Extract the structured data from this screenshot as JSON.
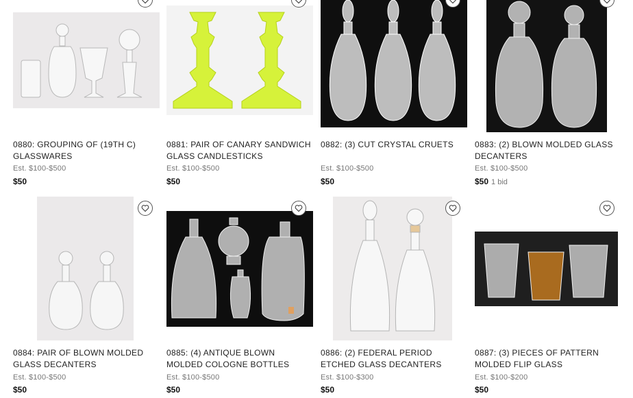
{
  "lots": [
    {
      "lot": "0880",
      "title": "GROUPING OF (19th C) GLASSWARES",
      "estimate": "Est.  $100-$500",
      "price": "$50",
      "bids": ""
    },
    {
      "lot": "0881",
      "title": "PAIR OF CANARY SANDWICH GLASS CANDLESTICKS",
      "estimate": "Est.  $100-$500",
      "price": "$50",
      "bids": ""
    },
    {
      "lot": "0882",
      "title": "(3) CUT CRYSTAL CRUETS",
      "estimate": "Est.  $100-$500",
      "price": "$50",
      "bids": ""
    },
    {
      "lot": "0883",
      "title": "(2) BLOWN MOLDED GLASS DECANTERS",
      "estimate": "Est.  $100-$500",
      "price": "$50",
      "bids": "1 bid"
    },
    {
      "lot": "0884",
      "title": "PAIR OF BLOWN MOLDED GLASS DECANTERS",
      "estimate": "Est.  $100-$500",
      "price": "$50",
      "bids": ""
    },
    {
      "lot": "0885",
      "title": "(4) ANTIQUE BLOWN MOLDED COLOGNE BOTTLES",
      "estimate": "Est.  $100-$500",
      "price": "$50",
      "bids": ""
    },
    {
      "lot": "0886",
      "title": "(2) FEDERAL PERIOD ETCHED GLASS DECANTERS",
      "estimate": "Est.  $100-$300",
      "price": "$50",
      "bids": ""
    },
    {
      "lot": "0887",
      "title": "(3) PIECES OF PATTERN MOLDED FLIP GLASS",
      "estimate": "Est.  $100-$200",
      "price": "$50",
      "bids": ""
    }
  ],
  "heading_separator": ":  ",
  "icons": {
    "favorite": "heart-outline-icon"
  }
}
